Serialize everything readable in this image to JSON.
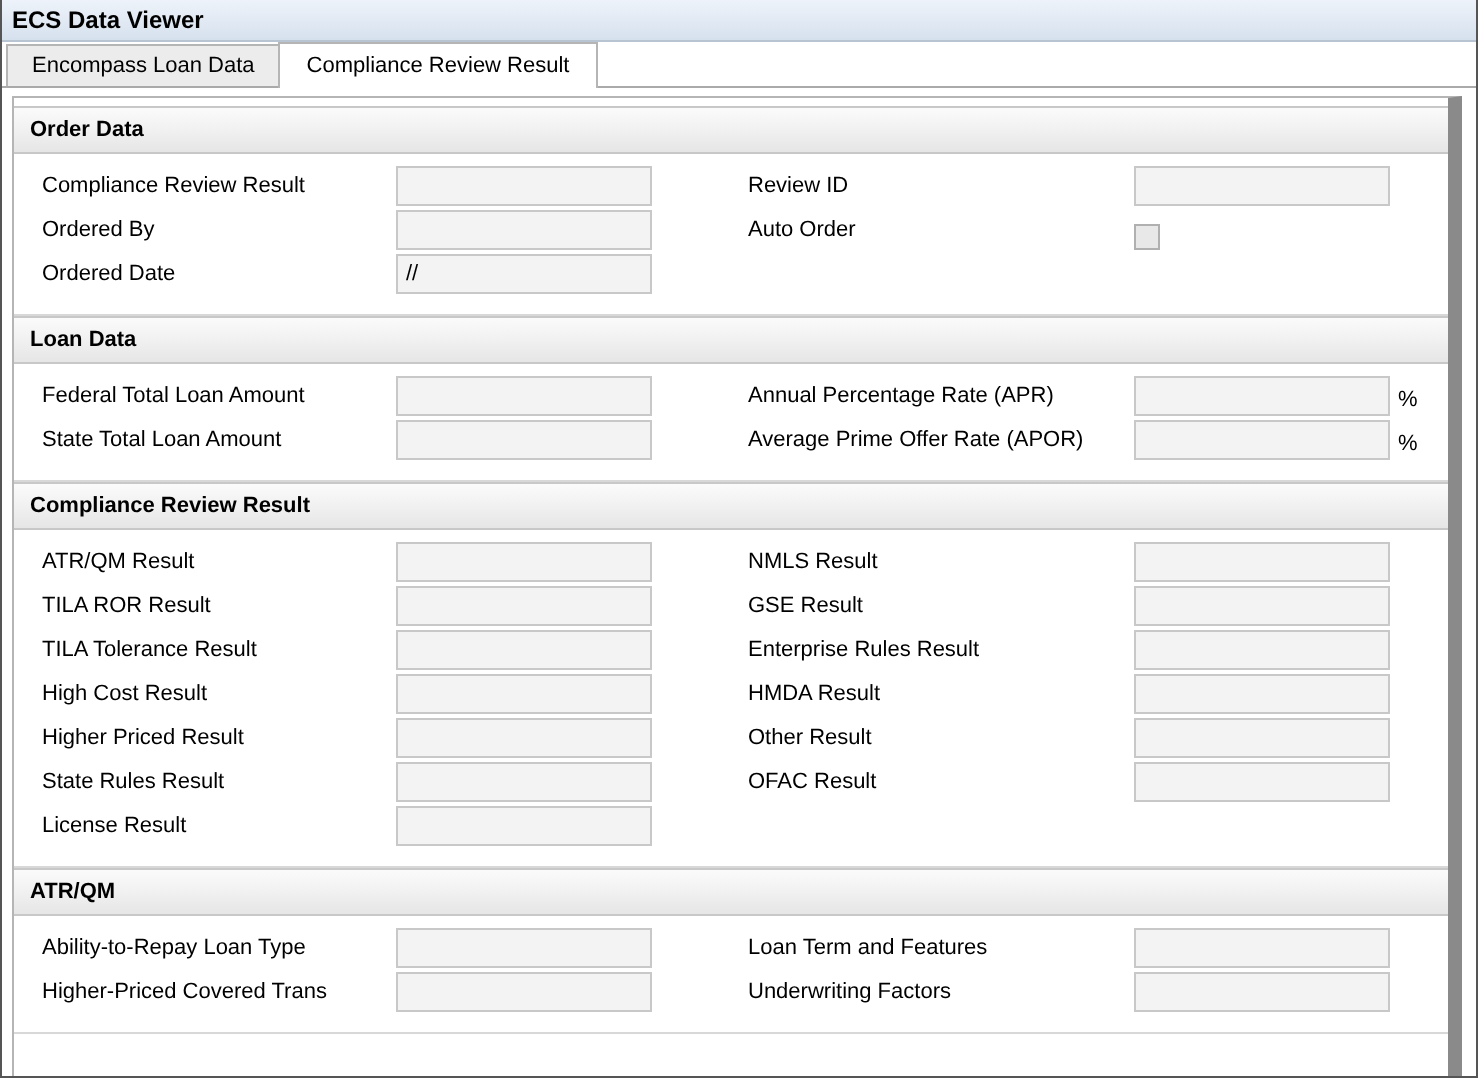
{
  "window": {
    "title": "ECS Data Viewer"
  },
  "tabs": [
    {
      "label": "Encompass Loan Data",
      "selected": false
    },
    {
      "label": "Compliance Review Result",
      "selected": true
    }
  ],
  "sections": [
    {
      "title": "Order Data",
      "left": [
        {
          "kind": "field",
          "label": "Compliance Review Result"
        },
        {
          "kind": "field",
          "label": "Ordered By"
        },
        {
          "kind": "field",
          "label": "Ordered Date",
          "value": "//"
        }
      ],
      "right": [
        {
          "kind": "field",
          "label": "Review ID"
        },
        {
          "kind": "checkbox",
          "label": "Auto Order",
          "checked": false
        }
      ]
    },
    {
      "title": "Loan Data",
      "left": [
        {
          "kind": "field",
          "label": "Federal Total Loan Amount"
        },
        {
          "kind": "field",
          "label": "State Total Loan Amount"
        }
      ],
      "right": [
        {
          "kind": "field",
          "label": "Annual Percentage Rate (APR)",
          "suffix": "%"
        },
        {
          "kind": "field",
          "label": "Average Prime Offer Rate (APOR)",
          "suffix": "%"
        }
      ]
    },
    {
      "title": "Compliance Review Result",
      "left": [
        {
          "kind": "field",
          "label": "ATR/QM Result"
        },
        {
          "kind": "field",
          "label": "TILA ROR Result"
        },
        {
          "kind": "field",
          "label": "TILA Tolerance Result"
        },
        {
          "kind": "field",
          "label": "High Cost Result"
        },
        {
          "kind": "field",
          "label": "Higher Priced Result"
        },
        {
          "kind": "field",
          "label": "State Rules Result"
        },
        {
          "kind": "field",
          "label": "License Result"
        }
      ],
      "right": [
        {
          "kind": "field",
          "label": "NMLS Result"
        },
        {
          "kind": "field",
          "label": "GSE Result"
        },
        {
          "kind": "field",
          "label": "Enterprise Rules Result"
        },
        {
          "kind": "field",
          "label": "HMDA Result"
        },
        {
          "kind": "field",
          "label": "Other Result"
        },
        {
          "kind": "field",
          "label": "OFAC Result"
        }
      ]
    },
    {
      "title": "ATR/QM",
      "left": [
        {
          "kind": "field",
          "label": "Ability-to-Repay Loan Type"
        },
        {
          "kind": "field",
          "label": "Higher-Priced Covered Trans"
        }
      ],
      "right": [
        {
          "kind": "field",
          "label": "Loan Term and Features"
        },
        {
          "kind": "field",
          "label": "Underwriting Factors"
        }
      ]
    }
  ]
}
